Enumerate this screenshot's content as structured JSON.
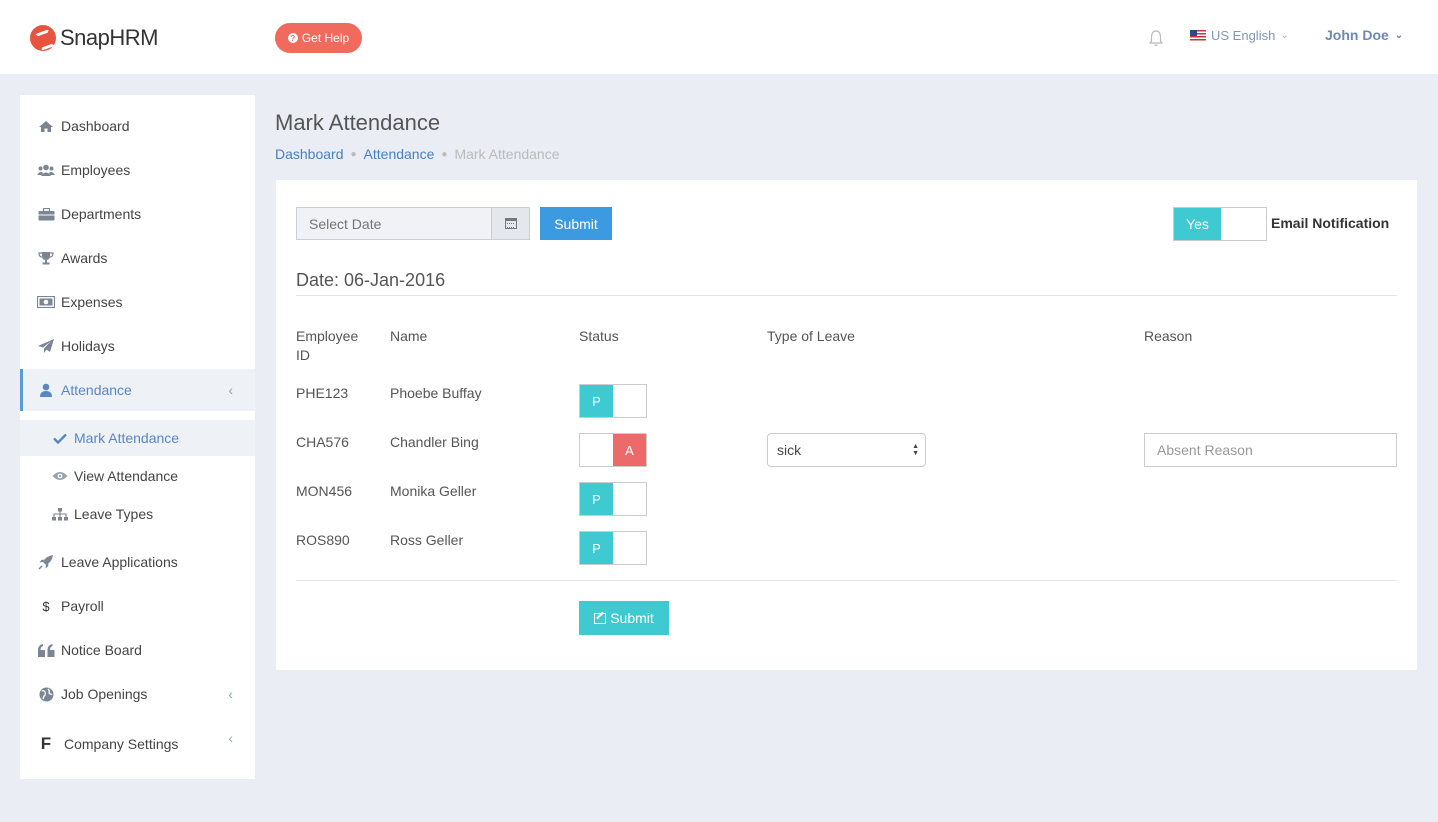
{
  "header": {
    "brand": "SnapHRM",
    "help_label": "Get Help",
    "language": "US English",
    "user_name": "John Doe"
  },
  "sidebar": {
    "items": [
      {
        "label": "Dashboard",
        "icon": "home-icon"
      },
      {
        "label": "Employees",
        "icon": "users-icon"
      },
      {
        "label": "Departments",
        "icon": "briefcase-icon"
      },
      {
        "label": "Awards",
        "icon": "trophy-icon"
      },
      {
        "label": "Expenses",
        "icon": "money-icon"
      },
      {
        "label": "Holidays",
        "icon": "paper-plane-icon"
      },
      {
        "label": "Attendance",
        "icon": "user-icon"
      },
      {
        "label": "Leave Applications",
        "icon": "rocket-icon"
      },
      {
        "label": "Payroll",
        "icon": "dollar-icon"
      },
      {
        "label": "Notice Board",
        "icon": "quote-icon"
      },
      {
        "label": "Job Openings",
        "icon": "globe-icon"
      },
      {
        "label": "Company Settings",
        "icon": "f-icon"
      }
    ],
    "attendance_sub": [
      {
        "label": "Mark Attendance",
        "icon": "check-icon"
      },
      {
        "label": "View Attendance",
        "icon": "eye-icon"
      },
      {
        "label": "Leave Types",
        "icon": "sitemap-icon"
      }
    ]
  },
  "page": {
    "title": "Mark Attendance",
    "breadcrumb": [
      "Dashboard",
      "Attendance",
      "Mark Attendance"
    ]
  },
  "form": {
    "date_placeholder": "Select Date",
    "submit_label": "Submit",
    "email_toggle_label": "Yes",
    "email_notification_label": "Email Notification",
    "date_heading": "Date: 06-Jan-2016",
    "bottom_submit_label": "Submit"
  },
  "table": {
    "headers": {
      "employee_id": "Employee ID",
      "name": "Name",
      "status": "Status",
      "type_of_leave": "Type of Leave",
      "reason": "Reason"
    },
    "rows": [
      {
        "id": "PHE123",
        "name": "Phoebe Buffay",
        "status": "P"
      },
      {
        "id": "CHA576",
        "name": "Chandler Bing",
        "status": "A",
        "leave_type": "sick",
        "reason_placeholder": "Absent Reason"
      },
      {
        "id": "MON456",
        "name": "Monika Geller",
        "status": "P"
      },
      {
        "id": "ROS890",
        "name": "Ross Geller",
        "status": "P"
      }
    ]
  },
  "colors": {
    "accent_blue": "#3c9ae0",
    "present": "#3fc9d1",
    "absent": "#ed6a6a",
    "help": "#f06b5e"
  }
}
